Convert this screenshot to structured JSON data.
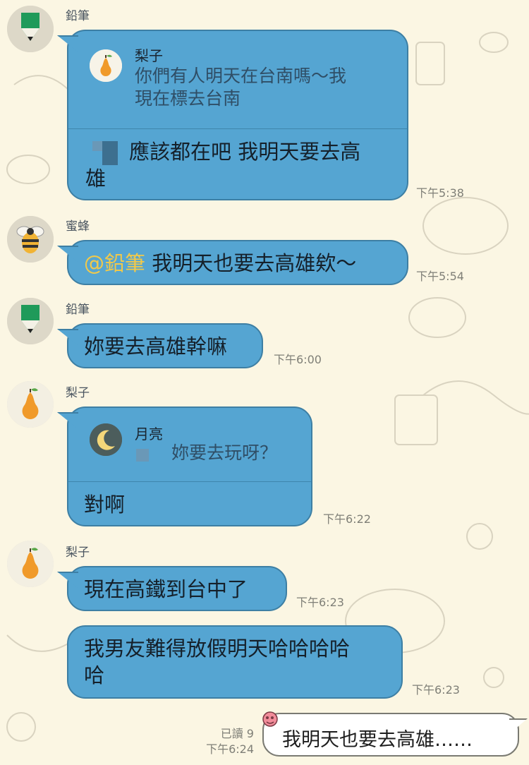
{
  "messages": {
    "m1": {
      "sender": "鉛筆",
      "reply_name": "梨子",
      "reply_quote": "你們有人明天在台南嗎～我\n現在標去台南",
      "text": "應該都在吧 我明天要去高\n雄",
      "time": "下午5:38"
    },
    "m2": {
      "sender": "蜜蜂",
      "mention": "@鉛筆",
      "text": " 我明天也要去高雄欸～",
      "time": "下午5:54"
    },
    "m3": {
      "sender": "鉛筆",
      "text": "妳要去高雄幹嘛",
      "time": "下午6:00"
    },
    "m4": {
      "sender": "梨子",
      "reply_name": "月亮",
      "reply_quote": "妳要去玩呀？",
      "text": "對啊",
      "time": "下午6:22"
    },
    "m5": {
      "sender": "梨子",
      "text": "現在高鐵到台中了",
      "time": "下午6:23"
    },
    "m6": {
      "text": "我男友難得放假明天哈哈哈哈\n哈",
      "time": "下午6:23"
    },
    "m7": {
      "read": "已讀 9",
      "time": "下午6:24",
      "text": "我明天也要去高雄……"
    }
  },
  "colors": {
    "bubble": "#55a5d2",
    "bubble_border": "#3d7fa4",
    "mention": "#f1c94a",
    "background": "#fbf6e3"
  },
  "icons": {
    "pencil": "pencil-avatar-icon",
    "bee": "bee-avatar-icon",
    "pear": "pear-avatar-icon",
    "moon": "moon-avatar-icon",
    "flower": "flower-sticker-icon"
  }
}
